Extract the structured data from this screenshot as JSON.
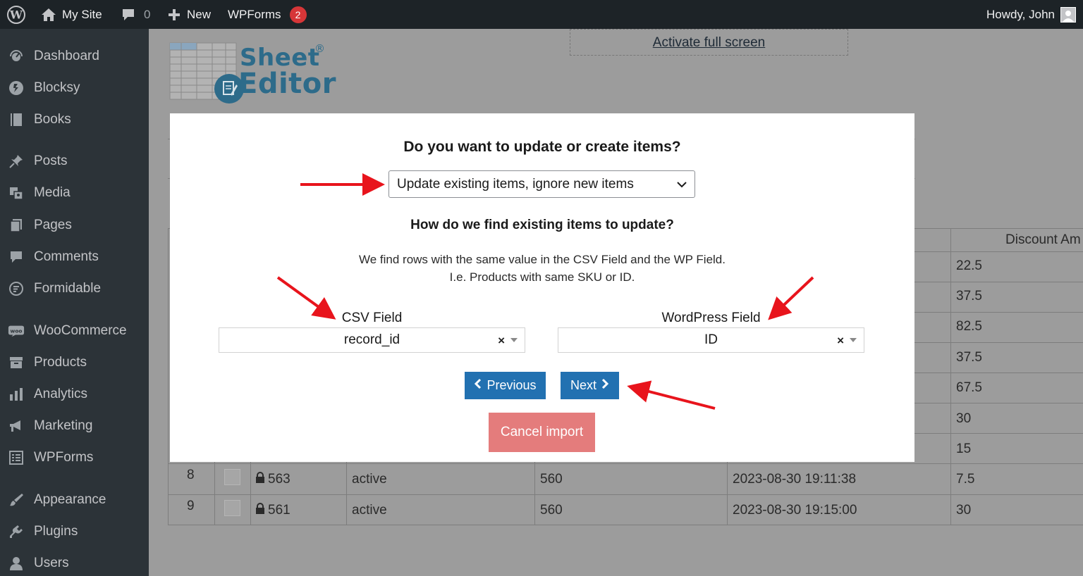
{
  "adminbar": {
    "site_name": "My Site",
    "comments_count": "0",
    "new_label": "New",
    "wpforms_label": "WPForms",
    "wpforms_badge": "2",
    "howdy": "Howdy, John"
  },
  "sidebar": {
    "items": [
      {
        "label": "Dashboard",
        "icon": "dashboard-icon"
      },
      {
        "label": "Blocksy",
        "icon": "blocksy-icon"
      },
      {
        "label": "Books",
        "icon": "book-icon"
      },
      {
        "label": "Posts",
        "icon": "pin-icon"
      },
      {
        "label": "Media",
        "icon": "media-icon"
      },
      {
        "label": "Pages",
        "icon": "pages-icon"
      },
      {
        "label": "Comments",
        "icon": "comment-icon"
      },
      {
        "label": "Formidable",
        "icon": "formidable-icon"
      },
      {
        "label": "WooCommerce",
        "icon": "woo-icon"
      },
      {
        "label": "Products",
        "icon": "archive-icon"
      },
      {
        "label": "Analytics",
        "icon": "bar-chart-icon"
      },
      {
        "label": "Marketing",
        "icon": "megaphone-icon"
      },
      {
        "label": "WPForms",
        "icon": "form-icon"
      },
      {
        "label": "Appearance",
        "icon": "brush-icon"
      },
      {
        "label": "Plugins",
        "icon": "plug-icon"
      },
      {
        "label": "Users",
        "icon": "user-icon"
      }
    ]
  },
  "toolbar": {
    "fullscreen_link": "Activate full screen"
  },
  "logo": {
    "line1": "Sheet",
    "line2": "Editor",
    "reg": "®"
  },
  "table": {
    "header_discount": "Discount Am",
    "discount_values": [
      "22.5",
      "37.5",
      "82.5",
      "37.5",
      "67.5",
      "30",
      "15"
    ],
    "rows": [
      {
        "num": "8",
        "id": "563",
        "status": "active",
        "parent": "560",
        "date": "2023-08-30 19:11:38",
        "discount": "7.5"
      },
      {
        "num": "9",
        "id": "561",
        "status": "active",
        "parent": "560",
        "date": "2023-08-30 19:15:00",
        "discount": "30"
      }
    ]
  },
  "modal": {
    "title": "Do you want to update or create items?",
    "mode_select": "Update existing items, ignore new items",
    "find_title": "How do we find existing items to update?",
    "desc_line1": "We find rows with the same value in the CSV Field and the WP Field.",
    "desc_line2": "I.e. Products with same SKU or ID.",
    "csv_field_label": "CSV Field",
    "csv_field_value": "record_id",
    "wp_field_label": "WordPress Field",
    "wp_field_value": "ID",
    "clear_symbol": "×",
    "previous_label": "Previous",
    "next_label": "Next",
    "cancel_label": "Cancel import"
  },
  "colors": {
    "adminbar_bg": "#1d2327",
    "sidebar_bg": "#2c3338",
    "primary_button": "#2271b1",
    "cancel_button": "#e47c7c",
    "annotation_arrow": "#e8141c",
    "badge": "#d63638"
  }
}
